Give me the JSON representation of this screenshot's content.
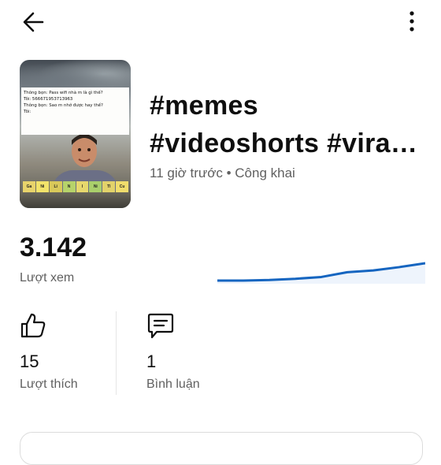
{
  "title": {
    "line1": "#memes",
    "line2": "#videoshorts #vira…"
  },
  "meta": "11 giờ trước • Công khai",
  "thumbnail": {
    "caption_lines": [
      "Thông bọn: Pass wifi nhà m là gì thế?",
      "Tôi: 566671953713963",
      "Thông bọn: Sao m nhớ được hay thế?",
      "Tôi:"
    ],
    "tiles": [
      "Ga",
      "Ni",
      "Li",
      "N",
      "I",
      "Ni",
      "Tl",
      "Cu"
    ],
    "tile_colors": [
      "#e8d36b",
      "#f2e36a",
      "#d9c95a",
      "#b6d36a",
      "#e7d86d",
      "#a9cf6b",
      "#e2d26a",
      "#f0dd6c"
    ]
  },
  "views": {
    "value": "3.142",
    "label": "Lượt xem"
  },
  "chart_data": {
    "type": "line",
    "title": "",
    "xlabel": "",
    "ylabel": "",
    "series": [
      {
        "values": [
          0,
          0,
          2,
          6,
          12,
          28,
          34,
          45,
          58
        ]
      }
    ],
    "line_color": "#1565c0"
  },
  "likes": {
    "value": "15",
    "label": "Lượt thích"
  },
  "comments": {
    "value": "1",
    "label": "Bình luận"
  },
  "icons": {
    "back": "arrow-left-icon",
    "more": "more-vertical-icon",
    "like": "thumbs-up-icon",
    "comment": "comment-icon"
  }
}
